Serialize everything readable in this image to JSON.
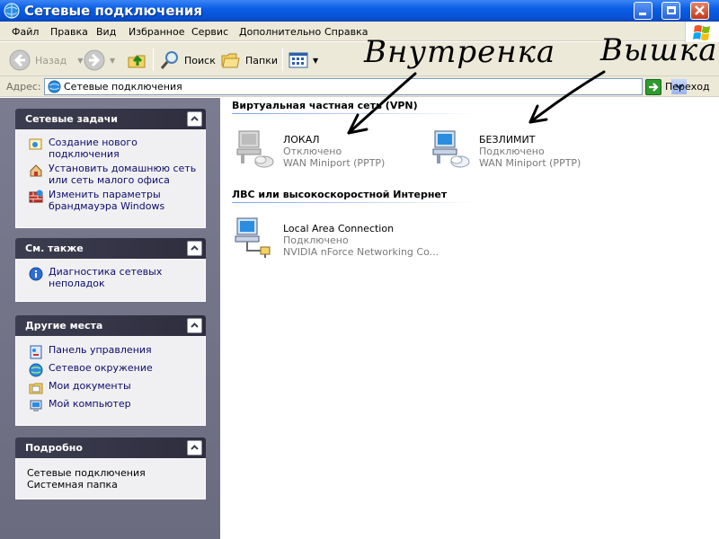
{
  "window": {
    "title": "Сетевые подключения"
  },
  "menu": {
    "items": [
      {
        "label": "Файл"
      },
      {
        "label": "Правка"
      },
      {
        "label": "Вид"
      },
      {
        "label": "Избранное"
      },
      {
        "label": "Сервис"
      },
      {
        "label": "Дополнительно"
      },
      {
        "label": "Справка"
      }
    ]
  },
  "toolbar": {
    "back": "Назад",
    "search": "Поиск",
    "folders": "Папки"
  },
  "address": {
    "label": "Адрес:",
    "value": "Сетевые подключения",
    "go": "Переход"
  },
  "panels": {
    "tasks": {
      "title": "Сетевые задачи",
      "items": [
        {
          "line1": "Создание нового",
          "line2": "подключения"
        },
        {
          "line1": "Установить домашнюю сеть",
          "line2": "или сеть малого офиса"
        },
        {
          "line1": "Изменить параметры",
          "line2": "брандмауэра Windows"
        }
      ]
    },
    "see_also": {
      "title": "См. также",
      "items": [
        {
          "line1": "Диагностика сетевых",
          "line2": "неполадок"
        }
      ]
    },
    "other": {
      "title": "Другие места",
      "items": [
        {
          "label": "Панель управления"
        },
        {
          "label": "Сетевое окружение"
        },
        {
          "label": "Мои документы"
        },
        {
          "label": "Мой компьютер"
        }
      ]
    },
    "details": {
      "title": "Подробно",
      "line1": "Сетевые подключения",
      "line2": "Системная папка"
    }
  },
  "groups": {
    "vpn": {
      "title": "Виртуальная частная сеть (VPN)",
      "connections": [
        {
          "name": "ЛОКАЛ",
          "status": "Отключено",
          "device": "WAN Miniport (PPTP)"
        },
        {
          "name": "БЕЗЛИМИТ",
          "status": "Подключено",
          "device": "WAN Miniport (PPTP)"
        }
      ]
    },
    "lan": {
      "title": "ЛВС или высокоскоростной Интернет",
      "connections": [
        {
          "name": "Local Area Connection",
          "status": "Подключено",
          "device": "NVIDIA nForce Networking Co..."
        }
      ]
    }
  },
  "annotations": {
    "left": "Внутренка",
    "right": "Вышка"
  }
}
